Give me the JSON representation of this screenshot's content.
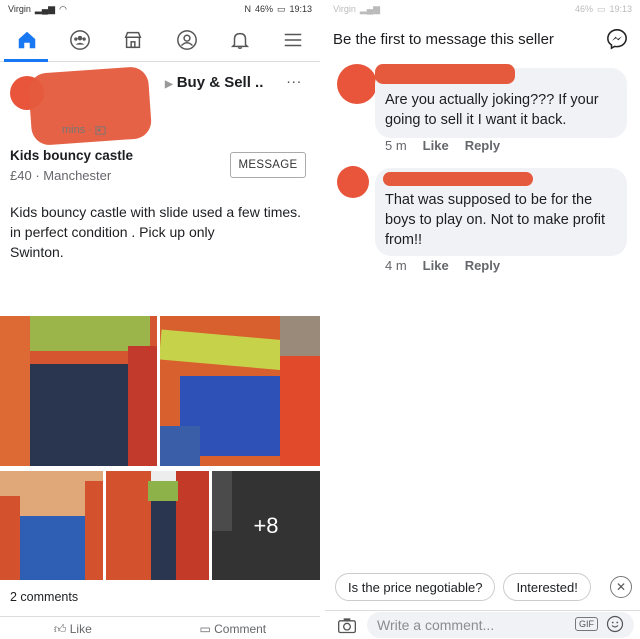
{
  "left": {
    "status": {
      "carrier": "Virgin",
      "battery": "46%",
      "time": "19:13"
    },
    "nav": {
      "icons": [
        "home-icon",
        "groups-icon",
        "marketplace-icon",
        "profile-icon",
        "bell-icon",
        "menu-icon"
      ],
      "accent": "#1877f2"
    },
    "post": {
      "title": "Buy & Sell ..",
      "meta_time": "mins",
      "more": "..."
    },
    "item": {
      "title": "Kids bouncy castle",
      "price": "£40",
      "location": "Manchester",
      "message_button": "MESSAGE"
    },
    "description": {
      "line1": "Kids bouncy castle with slide  used a few times.",
      "line2": " in perfect condition . Pick up only",
      "line3": "Swinton."
    },
    "photos": {
      "more_count": "+8"
    },
    "comments_count": "2 comments",
    "actions": {
      "like": "Like",
      "comment": "Comment"
    }
  },
  "right": {
    "status": {
      "carrier": "Virgin",
      "battery": "46%",
      "time": "19:13"
    },
    "header": "Be the first to message this seller",
    "comments": [
      {
        "text": "Are you actually joking??? If your going to sell it I want it back.",
        "time": "5 m",
        "like": "Like",
        "reply": "Reply"
      },
      {
        "text": "That was supposed to be for the boys to play on. Not to make profit from!!",
        "time": "4 m",
        "like": "Like",
        "reply": "Reply"
      }
    ],
    "quick_replies": [
      "Is the price negotiable?",
      "Interested!"
    ],
    "write_placeholder": "Write a comment...",
    "gif_label": "GIF"
  }
}
